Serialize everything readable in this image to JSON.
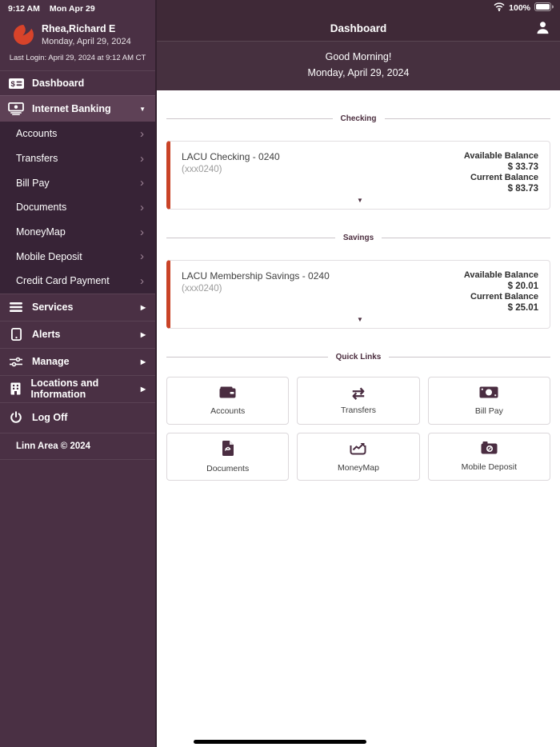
{
  "colors": {
    "accent": "#d8432a",
    "sidebar_bg": "#4a3044",
    "sidebar_subnav_bg": "#372336",
    "active_row_bg": "#5e4156",
    "header_bg": "#3f2937",
    "card_accent_border": "#c94327"
  },
  "status_bar": {
    "time": "9:12 AM",
    "date": "Mon Apr 29",
    "battery_percent": "100%"
  },
  "sidebar": {
    "user": {
      "name": "Rhea,Richard E",
      "date": "Monday, April 29, 2024",
      "last_login": "Last Login: April 29, 2024 at 9:12 AM CT"
    },
    "items": {
      "dashboard": "Dashboard",
      "internet_banking": "Internet Banking",
      "services": "Services",
      "alerts": "Alerts",
      "manage": "Manage",
      "locations": "Locations and Information",
      "log_off": "Log Off"
    },
    "internet_banking_children": [
      "Accounts",
      "Transfers",
      "Bill Pay",
      "Documents",
      "MoneyMap",
      "Mobile Deposit",
      "Credit Card Payment"
    ],
    "footer": "Linn Area © 2024"
  },
  "header": {
    "title": "Dashboard",
    "greeting": "Good Morning!",
    "greeting_date": "Monday, April 29, 2024"
  },
  "accounts": {
    "checking": {
      "section_label": "Checking",
      "name": "LACU Checking - 0240",
      "masked_number": "(xxx0240)",
      "available_balance_label": "Available Balance",
      "available_balance": "$ 33.73",
      "current_balance_label": "Current Balance",
      "current_balance": "$ 83.73"
    },
    "savings": {
      "section_label": "Savings",
      "name": "LACU Membership Savings - 0240",
      "masked_number": "(xxx0240)",
      "available_balance_label": "Available Balance",
      "available_balance": "$ 20.01",
      "current_balance_label": "Current Balance",
      "current_balance": "$ 25.01"
    }
  },
  "quick_links": {
    "section_label": "Quick Links",
    "items": [
      {
        "label": "Accounts",
        "icon": "wallet-icon"
      },
      {
        "label": "Transfers",
        "icon": "transfer-arrows-icon"
      },
      {
        "label": "Bill Pay",
        "icon": "banknote-icon"
      },
      {
        "label": "Documents",
        "icon": "pdf-file-icon"
      },
      {
        "label": "MoneyMap",
        "icon": "trend-chart-icon"
      },
      {
        "label": "Mobile Deposit",
        "icon": "camera-icon"
      }
    ]
  },
  "glyphs": {
    "chevron_down": "▼",
    "chevron_right": "›",
    "chevron_right_filled": "▶",
    "transfer_arrows": "⇄"
  }
}
